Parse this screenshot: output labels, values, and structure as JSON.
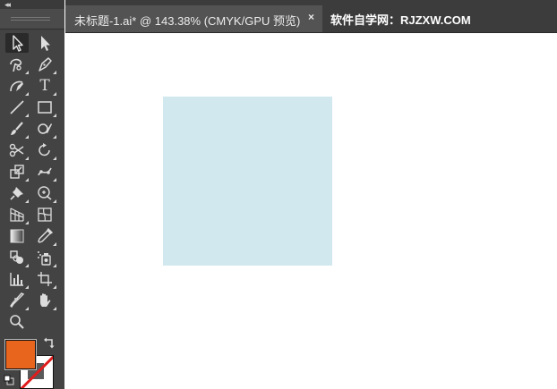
{
  "tabs": {
    "active_title": "未标题-1.ai* @ 143.38% (CMYK/GPU 预览)",
    "close_glyph": "×",
    "second_title": "软件自学网：RJZXW.COM"
  },
  "toolbar": {
    "collapse_glyph": "◂◂",
    "type_tool_glyph": "T"
  },
  "colors": {
    "fill": "#e8651e",
    "stroke": "none",
    "shape_fill": "#d1e8ee",
    "panel_bg": "#434343"
  },
  "tools": [
    "selection-tool",
    "direct-selection-tool",
    "magic-wand-tool",
    "pen-tool",
    "curvature-tool",
    "type-tool",
    "line-segment-tool",
    "rectangle-tool",
    "paintbrush-tool",
    "shaper-tool",
    "scissors-tool",
    "rotate-tool",
    "scale-tool",
    "puppet-warp-tool",
    "pin-tool",
    "shape-builder-tool",
    "perspective-grid-tool",
    "mesh-tool",
    "gradient-tool",
    "eyedropper-tool",
    "blend-tool",
    "symbol-sprayer-tool",
    "column-graph-tool",
    "artboard-tool",
    "slice-tool",
    "hand-tool",
    "zoom-tool"
  ]
}
